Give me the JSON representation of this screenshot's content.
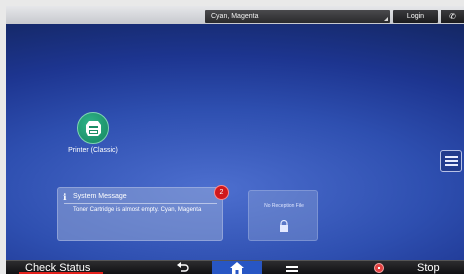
{
  "topbar": {
    "toner_status": "Cyan, Magenta",
    "login_label": "Login"
  },
  "desktop": {
    "apps": [
      {
        "label": "Printer (Classic)",
        "icon": "printer-icon"
      }
    ],
    "system_message": {
      "title": "System Message",
      "body": "Toner Cartridge is almost empty. Cyan, Magenta",
      "count": "2"
    },
    "reception_widget": {
      "label": "No Reception File"
    }
  },
  "bottombar": {
    "check_status_label": "Check Status",
    "stop_label": "Stop"
  },
  "colors": {
    "home_active": "#2856c4",
    "alert_red": "#d0181c",
    "app_green": "#16865f"
  }
}
